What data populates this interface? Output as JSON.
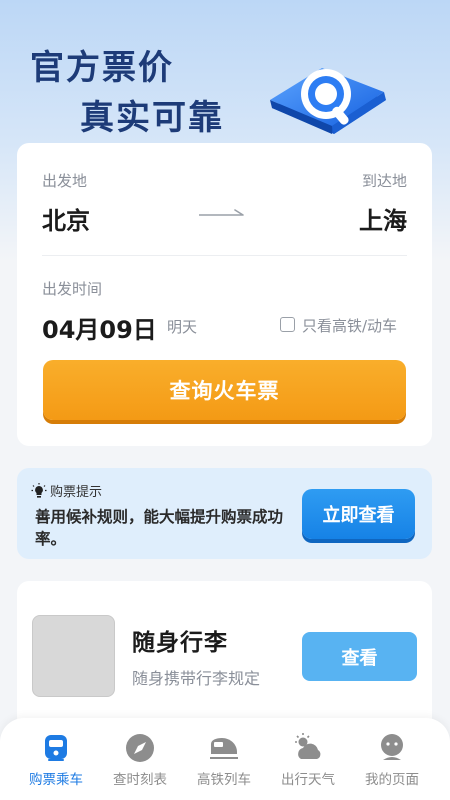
{
  "hero": {
    "line1": "官方票价",
    "line2": "真实可靠"
  },
  "search": {
    "from_label": "出发地",
    "from_city": "北京",
    "to_label": "到达地",
    "to_city": "上海",
    "time_label": "出发时间",
    "date": "04月09日",
    "date_hint": "明天",
    "highspeed_only": {
      "label": "只看高铁/动车",
      "checked": false
    },
    "query_button": "查询火车票"
  },
  "tip": {
    "header": "购票提示",
    "text": "善用候补规则，能大幅提升购票成功率。",
    "button": "立即查看"
  },
  "luggage": {
    "title": "随身行李",
    "subtitle": "随身携带行李规定",
    "button": "查看"
  },
  "tabs": [
    {
      "label": "购票乘车",
      "icon": "train-ticket-icon",
      "active": true
    },
    {
      "label": "查时刻表",
      "icon": "compass-icon",
      "active": false
    },
    {
      "label": "高铁列车",
      "icon": "bullet-train-icon",
      "active": false
    },
    {
      "label": "出行天气",
      "icon": "weather-icon",
      "active": false
    },
    {
      "label": "我的页面",
      "icon": "user-profile-icon",
      "active": false
    }
  ],
  "colors": {
    "accent_blue": "#1e7be3",
    "query_orange": "#f49a15",
    "hero_title": "#1d3b78",
    "tip_background": "#dfeefc"
  }
}
